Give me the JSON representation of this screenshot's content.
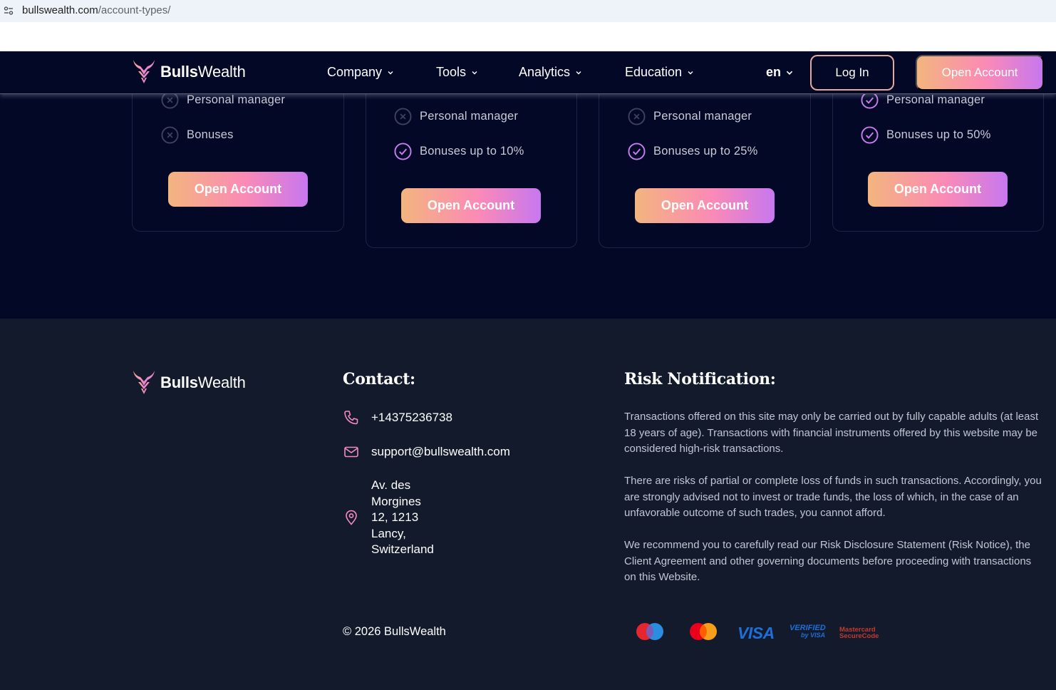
{
  "browser": {
    "url_domain": "bullswealth.com",
    "url_path": "/account-types/"
  },
  "header": {
    "logo_bold": "Bulls",
    "logo_light": "Wealth",
    "nav": [
      {
        "label": "Company"
      },
      {
        "label": "Tools"
      },
      {
        "label": "Analytics"
      },
      {
        "label": "Education"
      }
    ],
    "language": "en",
    "login_label": "Log In",
    "open_account_label": "Open Account"
  },
  "cards": [
    {
      "features": [
        {
          "label": "Personal manager",
          "included": false
        },
        {
          "label": "Bonuses",
          "included": false
        }
      ],
      "button": "Open Account"
    },
    {
      "features": [
        {
          "label": "Personal manager",
          "included": false
        },
        {
          "label": "Bonuses up to 10%",
          "included": true
        }
      ],
      "button": "Open Account"
    },
    {
      "features": [
        {
          "label": "Personal manager",
          "included": false
        },
        {
          "label": "Bonuses up to 25%",
          "included": true
        }
      ],
      "button": "Open Account"
    },
    {
      "features": [
        {
          "label": "Personal manager",
          "included": true
        },
        {
          "label": "Bonuses up to 50%",
          "included": true
        }
      ],
      "button": "Open Account"
    }
  ],
  "footer": {
    "logo_bold": "Bulls",
    "logo_light": "Wealth",
    "contact_heading": "Contact:",
    "phone": "+14375236738",
    "email": "support@bullswealth.com",
    "address_lines": [
      "Av. des",
      "Morgines",
      "12, 1213",
      "Lancy,",
      "Switzerland"
    ],
    "risk_heading": "Risk Notification:",
    "risk_paragraphs": [
      "Transactions offered on this site may only be carried out by fully capable adults (at least 18 years of age). Transactions with financial instruments offered by this website may be considered high-risk transactions.",
      "There are risks of partial or complete loss of funds in such transactions. Accordingly, you are strongly advised not to invest or trade funds, the loss of which, in the case of an unfavorable outcome of such trades, you cannot afford.",
      "We recommend you to carefully read our Risk Disclosure Statement (Risk Notice), the Client Agreement and other governing documents before proceeding with transactions on this Website."
    ],
    "copyright": "© 2026 BullsWealth",
    "payments": {
      "visa": "VISA",
      "verified_top": "VERIFIED",
      "verified_bottom": "by VISA",
      "mc_secure_top": "Mastercard",
      "mc_secure_bottom": "SecureCode"
    }
  },
  "colors": {
    "page_bg": "#040827",
    "footer_bg": "#121a2c",
    "accent_check": "#c77df0",
    "accent_orange": "#f3b57e",
    "accent_pink": "#fb8ab6"
  }
}
